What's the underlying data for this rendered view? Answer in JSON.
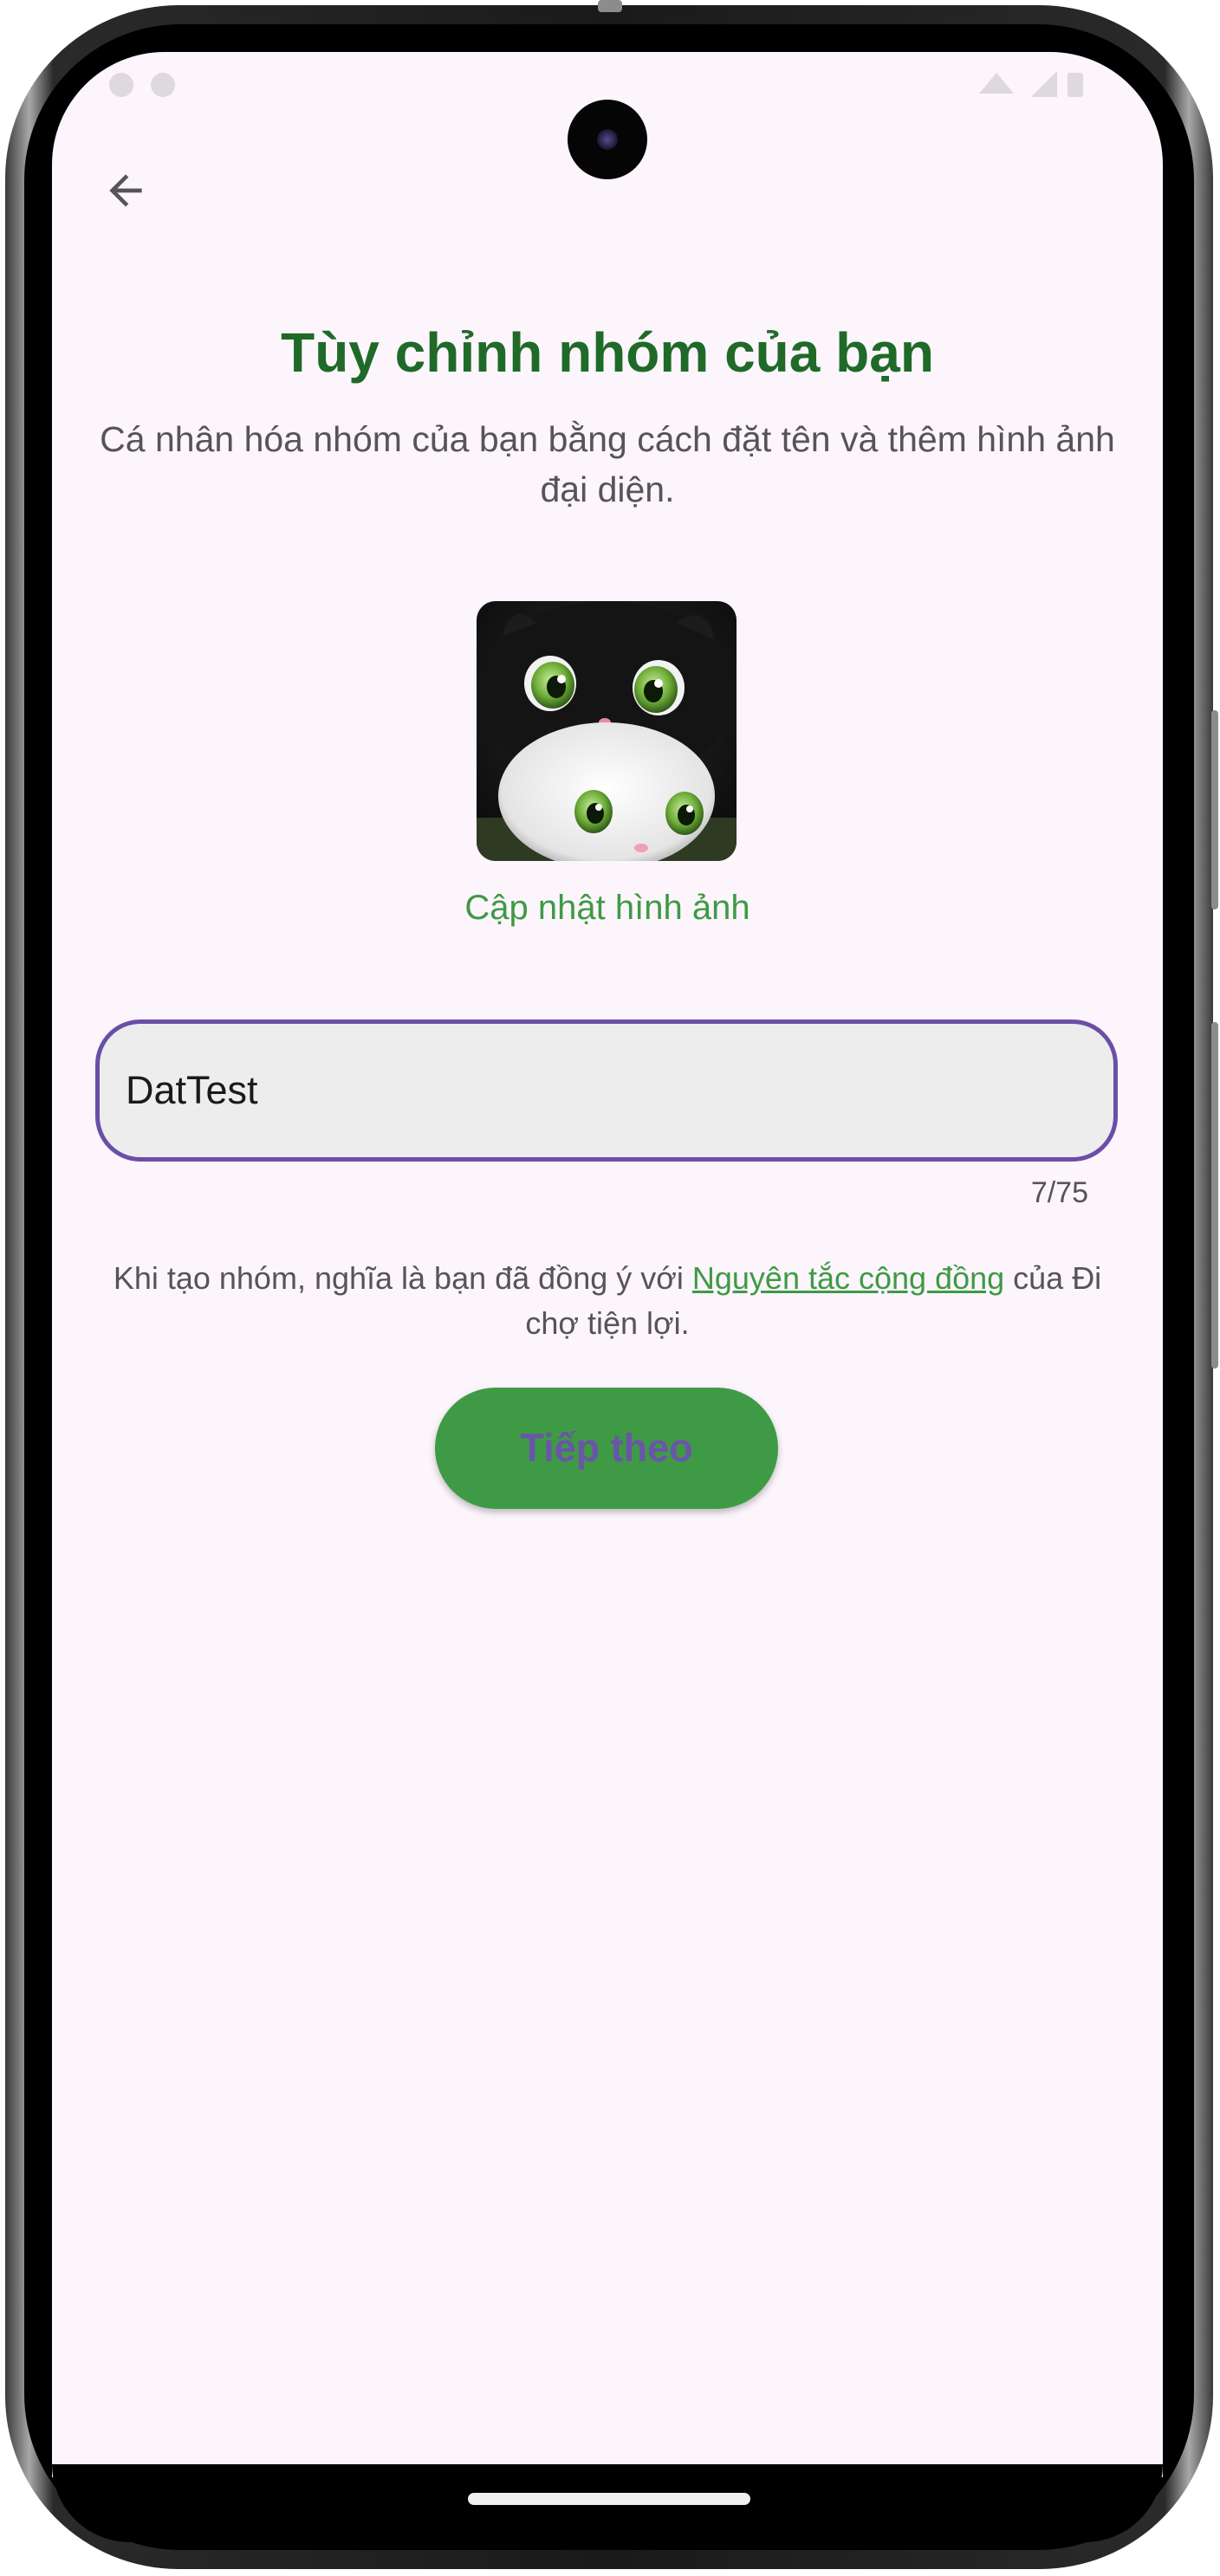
{
  "header": {
    "title": "Tùy chỉnh nhóm của bạn",
    "subtitle": "Cá nhân hóa nhóm của bạn bằng cách đặt tên và thêm hình ảnh đại diện."
  },
  "avatar": {
    "update_label": "Cập nhật hình ảnh"
  },
  "group_name": {
    "value": "DatTest",
    "counter": "7/75"
  },
  "terms": {
    "prefix": "Khi tạo nhóm, nghĩa là bạn đã đồng ý với ",
    "link": "Nguyên tắc cộng đồng",
    "suffix": " của Đi chợ tiện lợi."
  },
  "next_button": {
    "label": "Tiếp theo"
  },
  "colors": {
    "primary_green": "#1f6a28",
    "accent_green": "#3e9a44",
    "input_border_purple": "#6b4ea8",
    "background": "#fcf5fc"
  },
  "icons": {
    "back": "arrow-left-icon"
  }
}
